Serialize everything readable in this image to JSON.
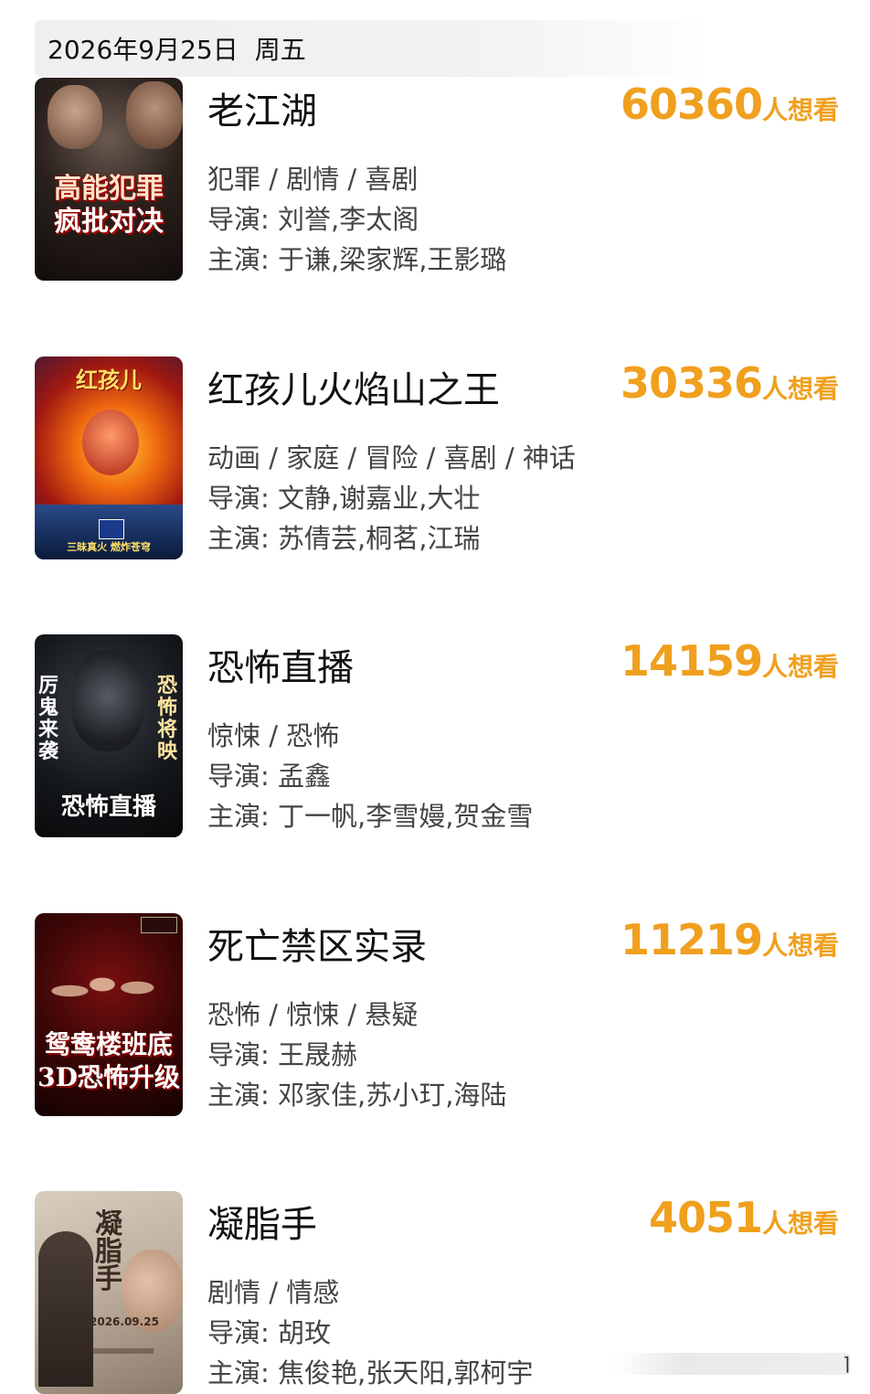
{
  "header": {
    "date": "2026年9月25日",
    "weekday": "周五"
  },
  "want_unit": "人想看",
  "movies": [
    {
      "title": "老江湖",
      "want_count": "60360",
      "genres": "犯罪 / 剧情 / 喜剧",
      "director": "导演: 刘誉,李太阁",
      "cast": "主演: 于谦,梁家辉,王影璐",
      "poster_text": [
        "高能犯罪",
        "疯批对决"
      ]
    },
    {
      "title": "红孩儿火焰山之王",
      "want_count": "30336",
      "genres": "动画 / 家庭 / 冒险 / 喜剧 / 神话",
      "director": "导演: 文静,谢嘉业,大壮",
      "cast": "主演: 苏倩芸,桐茗,江瑞",
      "poster_text": [
        "红孩儿",
        "三昧真火 燃炸苍穹"
      ]
    },
    {
      "title": "恐怖直播",
      "want_count": "14159",
      "genres": "惊悚 / 恐怖",
      "director": "导演: 孟鑫",
      "cast": "主演: 丁一帆,李雪嫚,贺金雪",
      "poster_text": [
        "厉鬼来袭",
        "恐怖将映",
        "恐怖直播"
      ]
    },
    {
      "title": "死亡禁区实录",
      "want_count": "11219",
      "genres": "恐怖 / 惊悚 / 悬疑",
      "director": "导演: 王晟赫",
      "cast": "主演: 邓家佳,苏小玎,海陆",
      "poster_text": [
        "鸳鸯楼班底",
        "3D恐怖升级"
      ]
    },
    {
      "title": "凝脂手",
      "want_count": "4051",
      "genres": "剧情 / 情感",
      "director": "导演: 胡玫",
      "cast": "主演: 焦俊艳,张天阳,郭柯宇",
      "poster_text": [
        "凝脂手",
        "2026.09.25"
      ]
    }
  ],
  "colors": {
    "want_accent": "#f0a01e",
    "text_primary": "#111111",
    "text_secondary": "#444444"
  }
}
